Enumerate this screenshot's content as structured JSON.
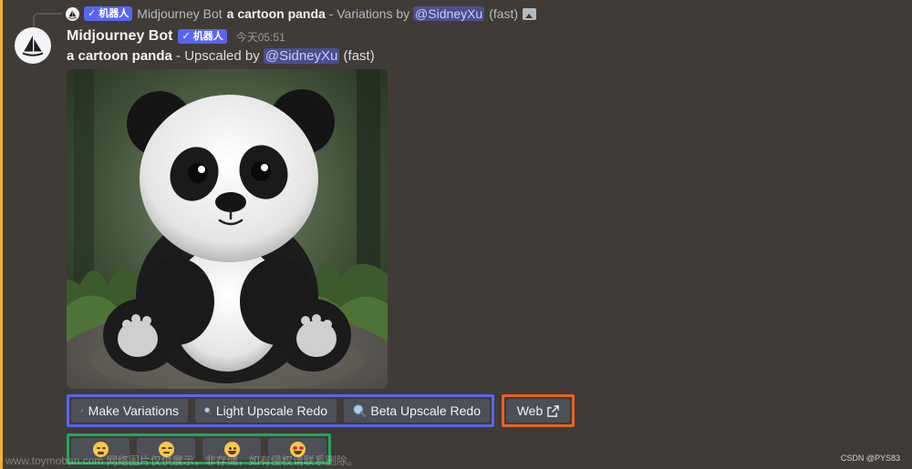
{
  "reply": {
    "bot_name": "Midjourney Bot",
    "badge": "✓ 机器人",
    "prompt": "a cartoon panda",
    "action_text": " - Variations by ",
    "mention": "@SidneyXu",
    "speed": "(fast)"
  },
  "message": {
    "username": "Midjourney Bot",
    "badge": "✓ 机器人",
    "timestamp": "今天05:51",
    "prompt": "a cartoon panda",
    "action_text": " - Upscaled by ",
    "mention": "@SidneyXu",
    "speed": "(fast)"
  },
  "buttons": {
    "make_variations": "Make Variations",
    "light_upscale_redo": "Light Upscale Redo",
    "beta_upscale_redo": "Beta Upscale Redo",
    "web": "Web"
  },
  "reactions": [
    "persevering-face",
    "unamused-face",
    "grinning-face",
    "heart-eyes-face"
  ],
  "watermark": "www.toymoban.com 网络图片仅供展示，非存储，如有侵权请联系删除。",
  "credit": "CSDN @PYS83",
  "colors": {
    "background": "#403b37",
    "blurple": "#5865f2",
    "highlight_blue": "#5865f2",
    "highlight_orange": "#e8631c",
    "highlight_green": "#23a559",
    "accent_bar": "#f0b232"
  }
}
